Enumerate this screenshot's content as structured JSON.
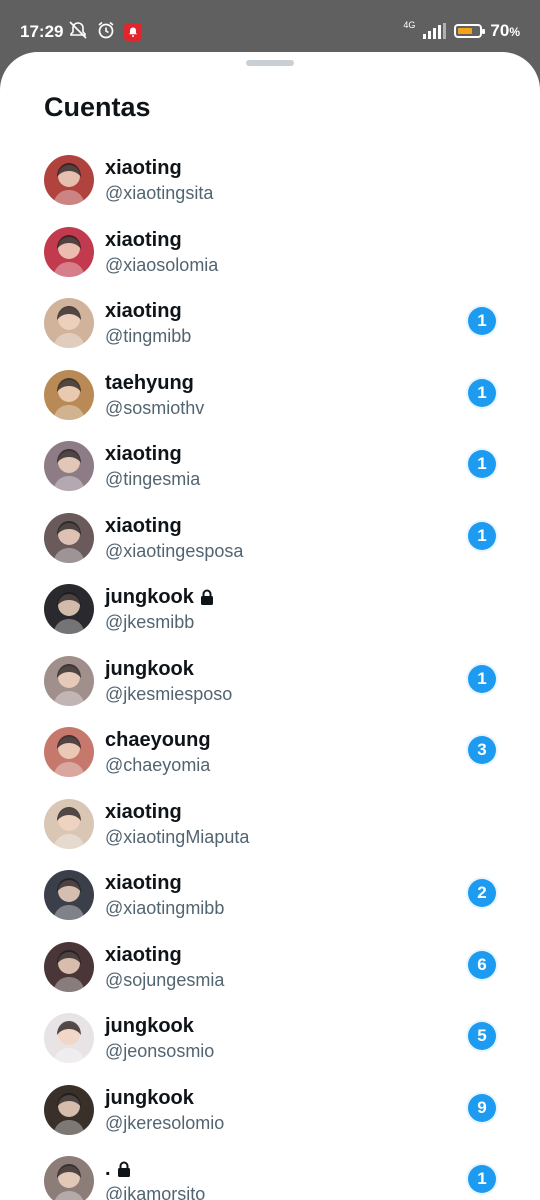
{
  "status_bar": {
    "time": "17:29",
    "network": "4G",
    "battery_percent": "70",
    "battery_unit": "%",
    "battery_level": 0.7,
    "icons": [
      "notifications-off-icon",
      "alarm-icon",
      "app-notification-icon",
      "signal-icon",
      "battery-icon"
    ]
  },
  "sheet": {
    "title": "Cuentas"
  },
  "accounts": [
    {
      "name": "xiaoting",
      "handle": "@xiaotingsita",
      "badge": "",
      "locked": false,
      "avatar_color": "#b0433e"
    },
    {
      "name": "xiaoting",
      "handle": "@xiaosolomia",
      "badge": "",
      "locked": false,
      "avatar_color": "#c23a4d"
    },
    {
      "name": "xiaoting",
      "handle": "@tingmibb",
      "badge": "1",
      "locked": false,
      "avatar_color": "#d1b39c"
    },
    {
      "name": "taehyung",
      "handle": "@sosmiothv",
      "badge": "1",
      "locked": false,
      "avatar_color": "#b98a55"
    },
    {
      "name": "xiaoting",
      "handle": "@tingesmia",
      "badge": "1",
      "locked": false,
      "avatar_color": "#8d7c86"
    },
    {
      "name": "xiaoting",
      "handle": "@xiaotingesposa",
      "badge": "1",
      "locked": false,
      "avatar_color": "#6a5a5c"
    },
    {
      "name": "jungkook",
      "handle": "@jkesmibb",
      "badge": "",
      "locked": true,
      "avatar_color": "#2a2a2e"
    },
    {
      "name": "jungkook",
      "handle": "@jkesmiesposo",
      "badge": "1",
      "locked": false,
      "avatar_color": "#a08f8b"
    },
    {
      "name": "chaeyoung",
      "handle": "@chaeyomia",
      "badge": "3",
      "locked": false,
      "avatar_color": "#c6786c"
    },
    {
      "name": "xiaoting",
      "handle": "@xiaotingMiaputa",
      "badge": "",
      "locked": false,
      "avatar_color": "#d9c6b4"
    },
    {
      "name": "xiaoting",
      "handle": "@xiaotingmibb",
      "badge": "2",
      "locked": false,
      "avatar_color": "#3b3f4a"
    },
    {
      "name": "xiaoting",
      "handle": "@sojungesmia",
      "badge": "6",
      "locked": false,
      "avatar_color": "#4a3638"
    },
    {
      "name": "jungkook",
      "handle": "@jeonsosmio",
      "badge": "5",
      "locked": false,
      "avatar_color": "#e8e4e6"
    },
    {
      "name": "jungkook",
      "handle": "@jkeresolomio",
      "badge": "9",
      "locked": false,
      "avatar_color": "#3a302a"
    },
    {
      "name": ".",
      "handle": "@jkamorsito",
      "badge": "1",
      "locked": true,
      "avatar_color": "#8c7d78"
    }
  ]
}
